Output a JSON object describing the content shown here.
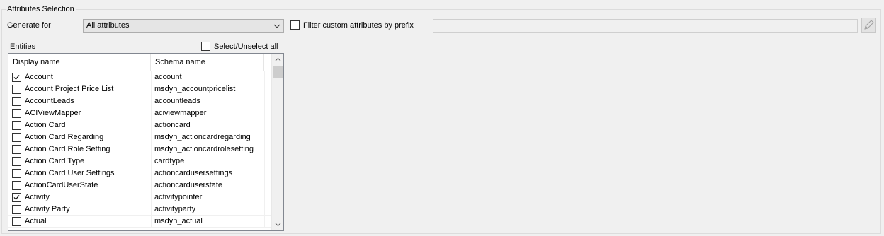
{
  "group": {
    "title": "Attributes Selection"
  },
  "generate": {
    "label": "Generate for",
    "selected": "All attributes"
  },
  "filter": {
    "label": "Filter custom attributes by prefix",
    "checked": false,
    "value": ""
  },
  "entities": {
    "label": "Entities",
    "select_all_label": "Select/Unselect all",
    "columns": {
      "display": "Display name",
      "schema": "Schema name"
    },
    "rows": [
      {
        "display": "Account",
        "schema": "account",
        "checked": true
      },
      {
        "display": "Account Project Price List",
        "schema": "msdyn_accountpricelist",
        "checked": false
      },
      {
        "display": "AccountLeads",
        "schema": "accountleads",
        "checked": false
      },
      {
        "display": "ACIViewMapper",
        "schema": "aciviewmapper",
        "checked": false
      },
      {
        "display": "Action Card",
        "schema": "actioncard",
        "checked": false
      },
      {
        "display": "Action Card Regarding",
        "schema": "msdyn_actioncardregarding",
        "checked": false
      },
      {
        "display": "Action Card Role Setting",
        "schema": "msdyn_actioncardrolesetting",
        "checked": false
      },
      {
        "display": "Action Card Type",
        "schema": "cardtype",
        "checked": false
      },
      {
        "display": "Action Card User Settings",
        "schema": "actioncardusersettings",
        "checked": false
      },
      {
        "display": "ActionCardUserState",
        "schema": "actioncarduserstate",
        "checked": false
      },
      {
        "display": "Activity",
        "schema": "activitypointer",
        "checked": true
      },
      {
        "display": "Activity Party",
        "schema": "activityparty",
        "checked": false
      },
      {
        "display": "Actual",
        "schema": "msdyn_actual",
        "checked": false
      }
    ]
  },
  "icons": {
    "dropdown": "chevron-down-icon",
    "edit": "pencil-icon",
    "scroll_up": "scroll-up-arrow-icon",
    "scroll_down": "scroll-down-arrow-icon"
  }
}
